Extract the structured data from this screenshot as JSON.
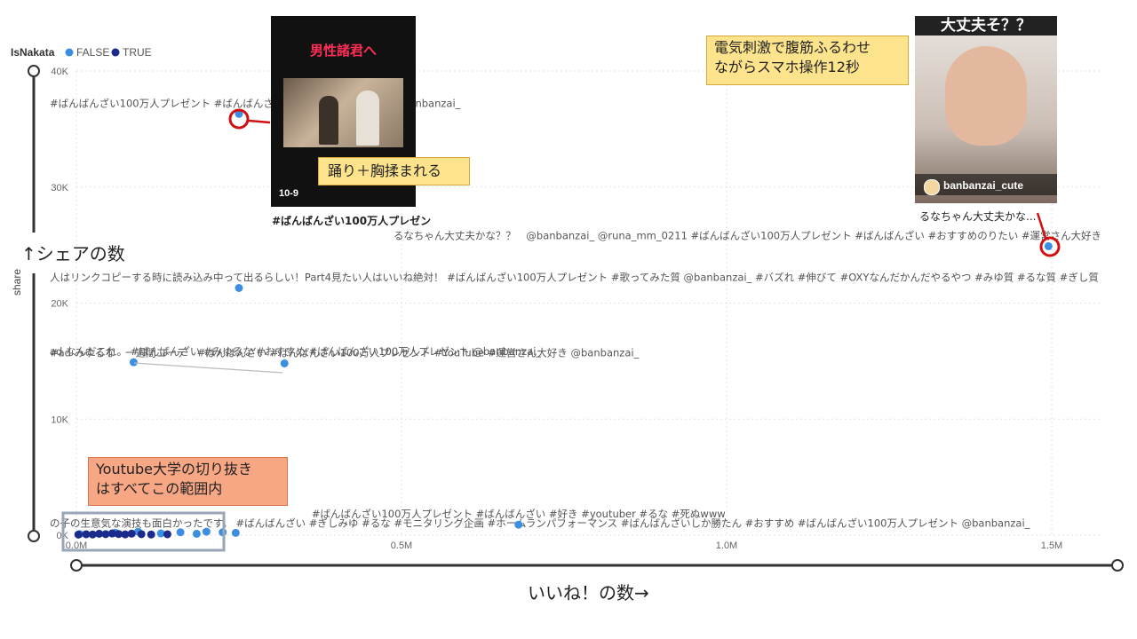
{
  "chart_data": {
    "type": "scatter",
    "legend": {
      "title": "IsNakata",
      "entries": [
        {
          "name": "FALSE",
          "color": "#3c8fe0"
        },
        {
          "name": "TRUE",
          "color": "#1a2b8c"
        }
      ],
      "placement": "top-left"
    },
    "xlabel": "",
    "ylabel": "share",
    "xlim": [
      0,
      1500000
    ],
    "ylim": [
      0,
      40000
    ],
    "x_ticks": [
      {
        "value": 0,
        "label": "0.0M"
      },
      {
        "value": 500000,
        "label": "0.5M"
      },
      {
        "value": 1000000,
        "label": "1.0M"
      },
      {
        "value": 1500000,
        "label": "1.5M"
      }
    ],
    "y_ticks": [
      {
        "value": 0,
        "label": "0K"
      },
      {
        "value": 10000,
        "label": "10K"
      },
      {
        "value": 20000,
        "label": "20K"
      },
      {
        "value": 30000,
        "label": "30K"
      },
      {
        "value": 40000,
        "label": "40K"
      }
    ],
    "grid": true,
    "series": [
      {
        "name": "FALSE",
        "color": "#3c8fe0",
        "points": [
          {
            "x": 250000,
            "y": 36300,
            "label": "#ばんばんざい100万人プレゼント #ばんばんざい #どっちでも #バズれ @banbanzai_"
          },
          {
            "x": 1495000,
            "y": 24900,
            "label": "るなちゃん大丈夫かな？？　@banbanzai_ @runa_mm_0211 #ばんばんざい100万人プレゼント #ばんばんざい #おすすめのりたい #運営さん大好き"
          },
          {
            "x": 250000,
            "y": 21300,
            "label": "人はリンクコピーする時に読み込み中って出るらしい！Part4見たい人はいいね絶対！ #ばんばんざい100万人プレゼント #歌ってみた質 @banbanzai_ #バズれ #伸びて #OXYなんだかんだやるやつ #みゆ質 #るな質 #ぎし質"
          },
          {
            "x": 320000,
            "y": 14800,
            "label": "#ad みゆるな　一週間コーデ　#ばんばんざい #ばんばんざい100万人プレゼント #YouTube #運営さん大好き @banbanzai_"
          },
          {
            "x": 88000,
            "y": 14900,
            "label": "ad なんだこれ。 #ばんばんざい #みゆるな #おすすめ #ばんばんざい100万人プレゼント @banbanzai_"
          },
          {
            "x": 680000,
            "y": 900,
            "label": "#ばんばんざい100万人プレゼント #ばんばんざい #好き #youtuber #るな #死ぬwww"
          },
          {
            "x": 5000,
            "y": 100,
            "label": "の子の生意気な演技も面白かったです。 #ばんばんざい #ぎしみゆ #るな #モニタリング企画 #ホームランパフォーマンス #ばんばんざいしか勝たん #おすすめ #ばんばんざい100万人プレゼント @banbanzai_"
          },
          {
            "x": 60000,
            "y": 200,
            "label": ""
          },
          {
            "x": 95000,
            "y": 300,
            "label": ""
          },
          {
            "x": 130000,
            "y": 150,
            "label": ""
          },
          {
            "x": 160000,
            "y": 250,
            "label": ""
          },
          {
            "x": 185000,
            "y": 120,
            "label": ""
          },
          {
            "x": 200000,
            "y": 300,
            "label": ""
          },
          {
            "x": 225000,
            "y": 250,
            "label": ""
          },
          {
            "x": 245000,
            "y": 200,
            "label": ""
          }
        ]
      },
      {
        "name": "TRUE",
        "color": "#1a2b8c",
        "points": [
          {
            "x": 3000,
            "y": 50,
            "label": ""
          },
          {
            "x": 15000,
            "y": 80,
            "label": ""
          },
          {
            "x": 25000,
            "y": 60,
            "label": ""
          },
          {
            "x": 35000,
            "y": 120,
            "label": ""
          },
          {
            "x": 45000,
            "y": 90,
            "label": ""
          },
          {
            "x": 55000,
            "y": 150,
            "label": ""
          },
          {
            "x": 65000,
            "y": 100,
            "label": ""
          },
          {
            "x": 75000,
            "y": 70,
            "label": ""
          },
          {
            "x": 85000,
            "y": 130,
            "label": ""
          },
          {
            "x": 100000,
            "y": 90,
            "label": ""
          },
          {
            "x": 115000,
            "y": 60,
            "label": ""
          },
          {
            "x": 140000,
            "y": 80,
            "label": ""
          }
        ]
      }
    ],
    "annotations": {
      "y_caption": "↑シェアの数",
      "x_caption": "いいね！の数→",
      "callout_1": "電気刺激で腹筋ふるわせ\nながらスマホ操作12秒",
      "callout_2": "踊り＋胸揉まれる",
      "callout_3": "Youtube大学の切り抜き\nはすべてこの範囲内",
      "thumb_1_banner": "男性諸君へ",
      "thumb_1_corner": "10-9",
      "thumb_1_caption": "#ばんばんざい100万人プレゼン",
      "thumb_2_banner": "大丈夫そ？？",
      "thumb_2_handle": "banbanzai_cute",
      "thumb_2_caption": "るなちゃん大丈夫かな..."
    }
  }
}
